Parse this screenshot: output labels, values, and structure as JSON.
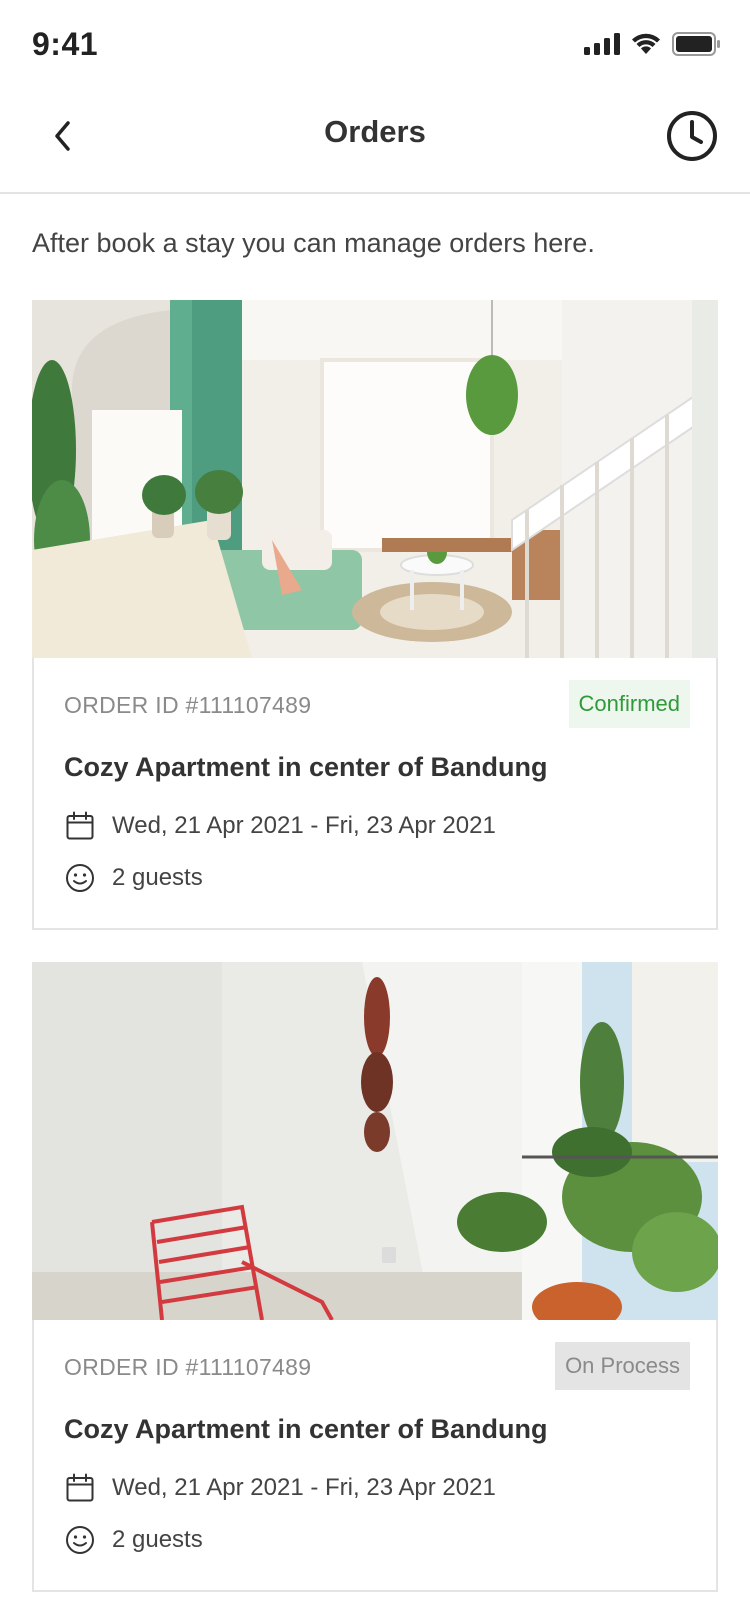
{
  "status_bar": {
    "time": "9:41"
  },
  "nav": {
    "title": "Orders",
    "back_icon": "chevron-left-icon",
    "history_icon": "clock-icon"
  },
  "intro_text": "After book a stay you can manage orders here.",
  "orders": [
    {
      "order_id": "ORDER ID #111107489",
      "status": "Confirmed",
      "status_color": "#2f9a3a",
      "name": "Cozy Apartment in center of Bandung",
      "dates": "Wed, 21 Apr 2021 - Fri, 23 Apr 2021",
      "guests": "2 guests"
    },
    {
      "order_id": "ORDER ID #111107489",
      "status": "On Process",
      "status_color": "#8a8a8a",
      "name": "Cozy Apartment in center of Bandung",
      "dates": "Wed, 21 Apr 2021 - Fri, 23 Apr 2021",
      "guests": "2 guests"
    }
  ]
}
